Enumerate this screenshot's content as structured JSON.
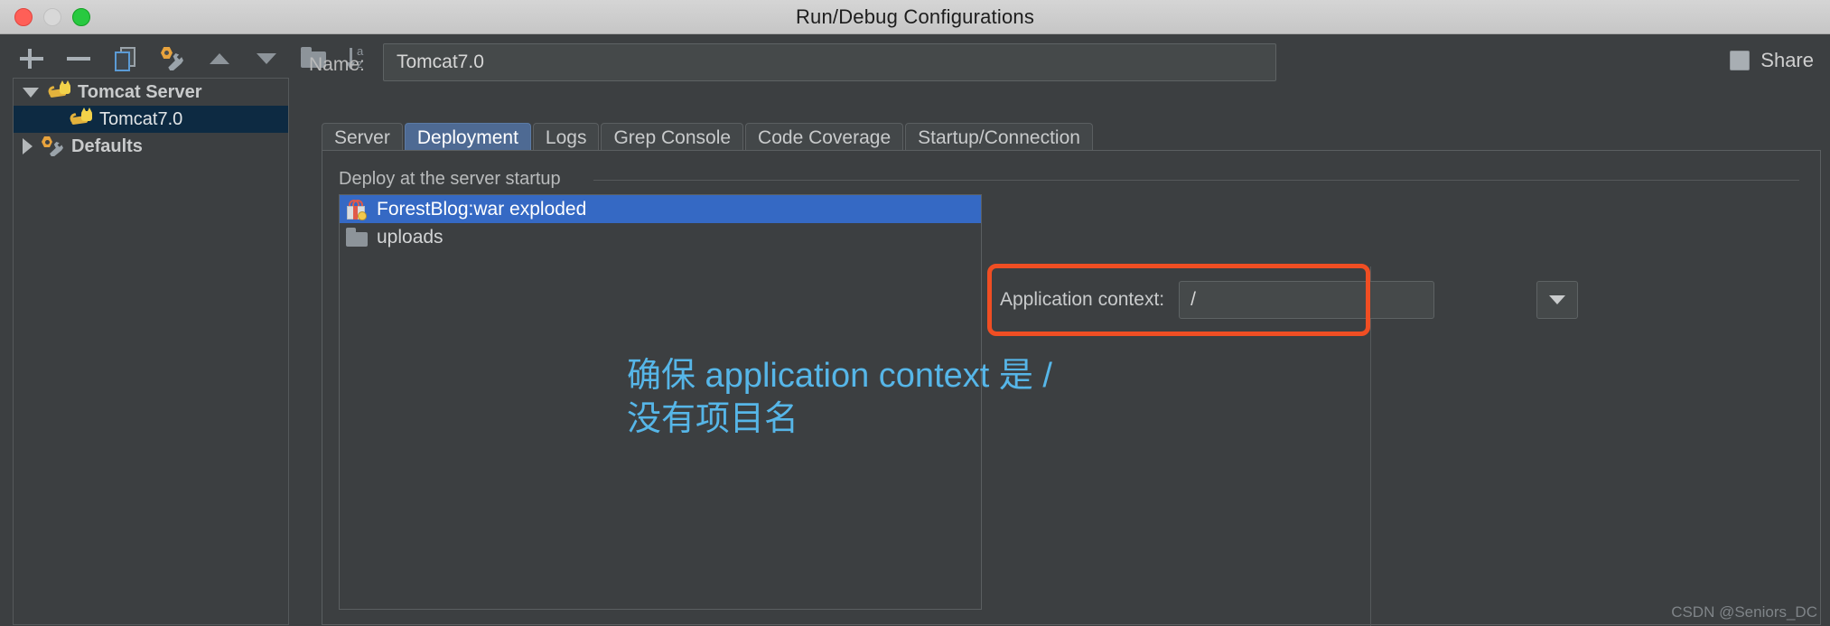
{
  "window": {
    "title": "Run/Debug Configurations",
    "traffic_lights": [
      "close",
      "minimize",
      "maximize"
    ]
  },
  "toolbar": {
    "icons": [
      {
        "name": "add-icon",
        "label": "+"
      },
      {
        "name": "remove-icon",
        "label": "−"
      },
      {
        "name": "copy-configuration-icon",
        "label": "Copy"
      },
      {
        "name": "edit-defaults-icon",
        "label": "Edit defaults"
      },
      {
        "name": "move-up-icon",
        "label": "Move up"
      },
      {
        "name": "move-down-icon",
        "label": "Move down"
      },
      {
        "name": "folder-icon",
        "label": "New folder"
      },
      {
        "name": "sort-alphabetically-icon",
        "label": "Sort"
      }
    ],
    "name_label": "Name:",
    "name_value": "Tomcat7.0",
    "share_label": "Share",
    "share_checked": false
  },
  "tree": {
    "items": [
      {
        "label": "Tomcat Server",
        "level": 1,
        "icon": "tomcat-cat-icon",
        "twisty": "open",
        "selected": false
      },
      {
        "label": "Tomcat7.0",
        "level": 2,
        "icon": "tomcat-cat-icon",
        "twisty": "none",
        "selected": true
      },
      {
        "label": "Defaults",
        "level": 1,
        "icon": "wrench-gear-icon",
        "twisty": "closed",
        "selected": false
      }
    ]
  },
  "tabs": [
    {
      "label": "Server",
      "active": false
    },
    {
      "label": "Deployment",
      "active": true
    },
    {
      "label": "Logs",
      "active": false
    },
    {
      "label": "Grep Console",
      "active": false
    },
    {
      "label": "Code Coverage",
      "active": false
    },
    {
      "label": "Startup/Connection",
      "active": false
    }
  ],
  "deployment": {
    "section_title": "Deploy at the server startup",
    "artifacts": [
      {
        "label": "ForestBlog:war exploded",
        "icon": "artifact-icon",
        "selected": true
      },
      {
        "label": "uploads",
        "icon": "folder-icon",
        "selected": false
      }
    ],
    "application_context_label": "Application context:",
    "application_context_value": "/",
    "dropdown_icon": "chevron-down-icon",
    "highlight_color": "#f04e23"
  },
  "annotation": {
    "text": "确保 application context 是 /\n没有项目名",
    "color": "#56b6e8"
  },
  "watermark": {
    "text": "CSDN @Seniors_DC"
  }
}
